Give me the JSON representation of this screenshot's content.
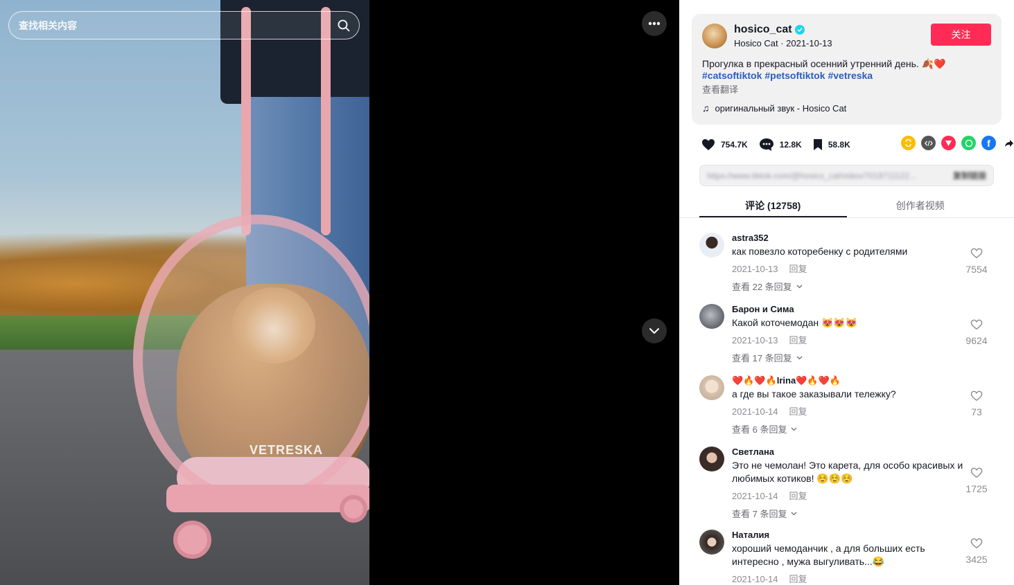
{
  "search": {
    "placeholder": "查找相关内容"
  },
  "video": {
    "watermark": "VETRESKA"
  },
  "author": {
    "handle": "hosico_cat",
    "display_name": "Hosico Cat",
    "date": "2021-10-13",
    "separator": " · ",
    "follow_label": "关注"
  },
  "post": {
    "caption": "Прогулка в прекрасный осенний утренний день. 🍂❤️",
    "hashtags": [
      "#catsoftiktok",
      "#petsoftiktok",
      "#vetreska"
    ],
    "translate_label": "查看翻译",
    "music": "оригинальный звук - Hosico Cat"
  },
  "stats": {
    "likes": "754.7K",
    "comments": "12.8K",
    "saves": "58.8K"
  },
  "share_icons": [
    {
      "name": "repost-icon",
      "color": "#fbbc05"
    },
    {
      "name": "embed-icon",
      "color": "#555555"
    },
    {
      "name": "send-icon",
      "color": "#fe2c55"
    },
    {
      "name": "whatsapp-icon",
      "color": "#25d366"
    },
    {
      "name": "facebook-icon",
      "color": "#1877f2"
    },
    {
      "name": "share-arrow-icon",
      "color": "#161823"
    }
  ],
  "link_box": {
    "url": "https://www.tiktok.com/@hosico_cat/video/7018711122...",
    "copy_label": "复制链接"
  },
  "tabs": [
    {
      "label": "评论 (12758)",
      "active": true
    },
    {
      "label": "创作者视频",
      "active": false
    }
  ],
  "comments": [
    {
      "name": "astra352",
      "text": "как повезло которебенку с родителями",
      "date": "2021-10-13",
      "reply_label": "回复",
      "replies_label": "查看 22 条回复",
      "likes": "7554",
      "avatar_color": "#c9d3df"
    },
    {
      "name": "Барон и Сима",
      "text": "Какой коточемодан 😻😻😻",
      "date": "2021-10-13",
      "reply_label": "回复",
      "replies_label": "查看 17 条回复",
      "likes": "9624",
      "avatar_color": "#7c7f86"
    },
    {
      "name": "❤️🔥❤️🔥Irina❤️🔥❤️🔥",
      "text": "а где вы такое заказывали тележку?",
      "date": "2021-10-14",
      "reply_label": "回复",
      "replies_label": "查看 6 条回复",
      "likes": "73",
      "avatar_color": "#e8d6c6"
    },
    {
      "name": "Светлана",
      "text": "Это не чемолан! Это карета, для особо красивых и любимых котиков! ☺️☺️☺️",
      "date": "2021-10-14",
      "reply_label": "回复",
      "replies_label": "查看 7 条回复",
      "likes": "1725",
      "avatar_color": "#4a3a34"
    },
    {
      "name": "Наталия",
      "text": "хороший чемоданчик , а для больших есть интересно , мужа выгуливать...😂",
      "date": "2021-10-14",
      "reply_label": "回复",
      "replies_label": "",
      "likes": "3425",
      "avatar_color": "#5b514c"
    }
  ]
}
